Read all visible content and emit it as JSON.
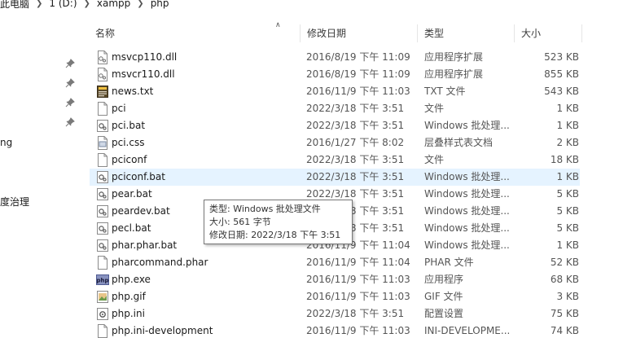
{
  "breadcrumb": [
    "此电脑",
    "1 (D:)",
    "xampp",
    "php"
  ],
  "nav": {
    "partial_labels": [
      "ng",
      "度治理"
    ]
  },
  "columns": {
    "name": "名称",
    "date": "修改日期",
    "type": "类型",
    "size": "大小"
  },
  "files": [
    {
      "name": "msvcp110.dll",
      "date": "2016/8/19 下午 11:09",
      "type": "应用程序扩展",
      "size": "523 KB",
      "icon": "dll-icon"
    },
    {
      "name": "msvcr110.dll",
      "date": "2016/8/19 下午 11:09",
      "type": "应用程序扩展",
      "size": "855 KB",
      "icon": "dll-icon"
    },
    {
      "name": "news.txt",
      "date": "2016/11/9 下午 11:03",
      "type": "TXT 文件",
      "size": "543 KB",
      "icon": "txt-icon"
    },
    {
      "name": "pci",
      "date": "2022/3/18 下午 3:51",
      "type": "文件",
      "size": "1 KB",
      "icon": "blank-file-icon"
    },
    {
      "name": "pci.bat",
      "date": "2022/3/18 下午 3:51",
      "type": "Windows 批处理...",
      "size": "1 KB",
      "icon": "bat-icon"
    },
    {
      "name": "pci.css",
      "date": "2016/1/27 下午 8:02",
      "type": "层叠样式表文档",
      "size": "2 KB",
      "icon": "css-icon"
    },
    {
      "name": "pciconf",
      "date": "2022/3/18 下午 3:51",
      "type": "文件",
      "size": "18 KB",
      "icon": "blank-file-icon"
    },
    {
      "name": "pciconf.bat",
      "date": "2022/3/18 下午 3:51",
      "type": "Windows 批处理...",
      "size": "1 KB",
      "icon": "bat-icon",
      "selected": true
    },
    {
      "name": "pear.bat",
      "date": "2022/3/18 下午 3:51",
      "type": "Windows 批处理...",
      "size": "5 KB",
      "icon": "bat-icon"
    },
    {
      "name": "peardev.bat",
      "date": "2022/3/18 下午 3:51",
      "type": "Windows 批处理...",
      "size": "5 KB",
      "icon": "bat-icon"
    },
    {
      "name": "pecl.bat",
      "date": "2022/3/18 下午 3:51",
      "type": "Windows 批处理...",
      "size": "5 KB",
      "icon": "bat-icon"
    },
    {
      "name": "phar.phar.bat",
      "date": "2016/11/9 下午 11:04",
      "type": "Windows 批处理...",
      "size": "1 KB",
      "icon": "bat-icon"
    },
    {
      "name": "pharcommand.phar",
      "date": "2016/11/9 下午 11:04",
      "type": "PHAR 文件",
      "size": "52 KB",
      "icon": "blank-file-icon"
    },
    {
      "name": "php.exe",
      "date": "2016/11/9 下午 11:03",
      "type": "应用程序",
      "size": "68 KB",
      "icon": "php-exe-icon"
    },
    {
      "name": "php.gif",
      "date": "2016/11/9 下午 11:03",
      "type": "GIF 文件",
      "size": "3 KB",
      "icon": "gif-icon"
    },
    {
      "name": "php.ini",
      "date": "2022/3/18 下午 3:51",
      "type": "配置设置",
      "size": "75 KB",
      "icon": "ini-icon"
    },
    {
      "name": "php.ini-development",
      "date": "2016/11/9 下午 11:03",
      "type": "INI-DEVELOPME...",
      "size": "74 KB",
      "icon": "blank-file-icon"
    }
  ],
  "tooltip": {
    "type_line": "类型: Windows 批处理文件",
    "size_line": "大小: 561 字节",
    "date_line": "修改日期: 2022/3/18 下午 3:51"
  },
  "colors": {
    "selected_row": "#e5f3ff",
    "header_text": "#3a3a3a",
    "secondary_text": "#555555"
  }
}
